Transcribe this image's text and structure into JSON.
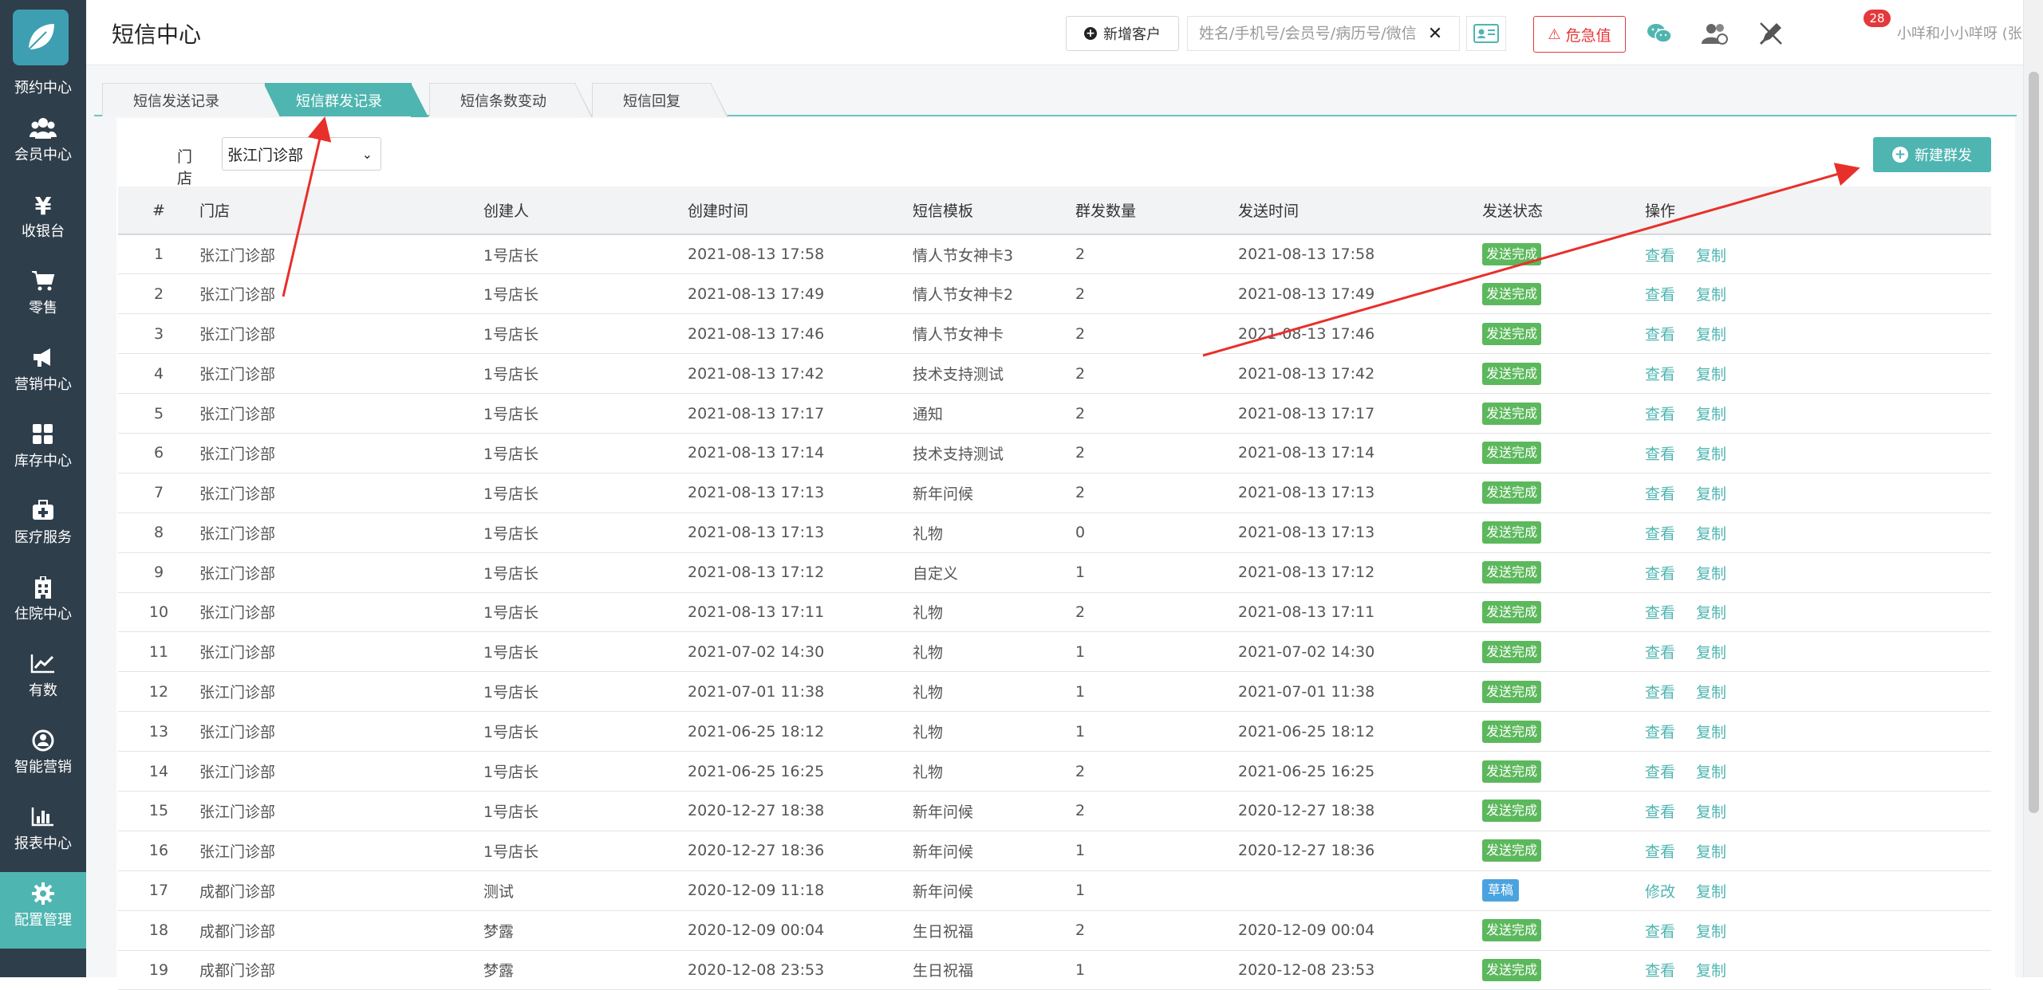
{
  "sidebar": {
    "partial_label": "预约中心",
    "items": [
      {
        "label": "会员中心",
        "icon": "members-icon"
      },
      {
        "label": "收银台",
        "icon": "yen-icon"
      },
      {
        "label": "零售",
        "icon": "cart-icon"
      },
      {
        "label": "营销中心",
        "icon": "megaphone-icon"
      },
      {
        "label": "库存中心",
        "icon": "grid-icon"
      },
      {
        "label": "医疗服务",
        "icon": "medical-kit-icon"
      },
      {
        "label": "住院中心",
        "icon": "hospital-icon"
      },
      {
        "label": "有数",
        "icon": "trend-icon"
      },
      {
        "label": "智能营销",
        "icon": "smart-marketing-icon"
      },
      {
        "label": "报表中心",
        "icon": "bar-chart-icon"
      },
      {
        "label": "配置管理",
        "icon": "gear-icon",
        "active": true
      }
    ]
  },
  "header": {
    "title": "短信中心",
    "add_customer": "新增客户",
    "search_placeholder": "姓名/手机号/会员号/病历号/微信号",
    "urgent": "危急值",
    "badge_count": "28",
    "user": "小咩和小小咩呀 (张江门诊部)"
  },
  "tabs": [
    {
      "label": "短信发送记录",
      "active": false
    },
    {
      "label": "短信群发记录",
      "active": true
    },
    {
      "label": "短信条数变动",
      "active": false
    },
    {
      "label": "短信回复",
      "active": false
    }
  ],
  "filter": {
    "store_label": "门店",
    "store_value": "张江门诊部"
  },
  "new_group_button": "新建群发",
  "table": {
    "columns": [
      "#",
      "门店",
      "创建人",
      "创建时间",
      "短信模板",
      "群发数量",
      "发送时间",
      "发送状态",
      "操作"
    ],
    "rows": [
      {
        "n": "1",
        "store": "张江门诊部",
        "creator": "1号店长",
        "created": "2021-08-13 17:58",
        "template": "情人节女神卡3",
        "count": "2",
        "sent": "2021-08-13 17:58",
        "status": "发送完成",
        "ops": [
          "查看",
          "复制"
        ]
      },
      {
        "n": "2",
        "store": "张江门诊部",
        "creator": "1号店长",
        "created": "2021-08-13 17:49",
        "template": "情人节女神卡2",
        "count": "2",
        "sent": "2021-08-13 17:49",
        "status": "发送完成",
        "ops": [
          "查看",
          "复制"
        ]
      },
      {
        "n": "3",
        "store": "张江门诊部",
        "creator": "1号店长",
        "created": "2021-08-13 17:46",
        "template": "情人节女神卡",
        "count": "2",
        "sent": "2021-08-13 17:46",
        "status": "发送完成",
        "ops": [
          "查看",
          "复制"
        ]
      },
      {
        "n": "4",
        "store": "张江门诊部",
        "creator": "1号店长",
        "created": "2021-08-13 17:42",
        "template": "技术支持测试",
        "count": "2",
        "sent": "2021-08-13 17:42",
        "status": "发送完成",
        "ops": [
          "查看",
          "复制"
        ]
      },
      {
        "n": "5",
        "store": "张江门诊部",
        "creator": "1号店长",
        "created": "2021-08-13 17:17",
        "template": "通知",
        "count": "2",
        "sent": "2021-08-13 17:17",
        "status": "发送完成",
        "ops": [
          "查看",
          "复制"
        ]
      },
      {
        "n": "6",
        "store": "张江门诊部",
        "creator": "1号店长",
        "created": "2021-08-13 17:14",
        "template": "技术支持测试",
        "count": "2",
        "sent": "2021-08-13 17:14",
        "status": "发送完成",
        "ops": [
          "查看",
          "复制"
        ]
      },
      {
        "n": "7",
        "store": "张江门诊部",
        "creator": "1号店长",
        "created": "2021-08-13 17:13",
        "template": "新年问候",
        "count": "2",
        "sent": "2021-08-13 17:13",
        "status": "发送完成",
        "ops": [
          "查看",
          "复制"
        ]
      },
      {
        "n": "8",
        "store": "张江门诊部",
        "creator": "1号店长",
        "created": "2021-08-13 17:13",
        "template": "礼物",
        "count": "0",
        "sent": "2021-08-13 17:13",
        "status": "发送完成",
        "ops": [
          "查看",
          "复制"
        ]
      },
      {
        "n": "9",
        "store": "张江门诊部",
        "creator": "1号店长",
        "created": "2021-08-13 17:12",
        "template": "自定义",
        "count": "1",
        "sent": "2021-08-13 17:12",
        "status": "发送完成",
        "ops": [
          "查看",
          "复制"
        ]
      },
      {
        "n": "10",
        "store": "张江门诊部",
        "creator": "1号店长",
        "created": "2021-08-13 17:11",
        "template": "礼物",
        "count": "2",
        "sent": "2021-08-13 17:11",
        "status": "发送完成",
        "ops": [
          "查看",
          "复制"
        ]
      },
      {
        "n": "11",
        "store": "张江门诊部",
        "creator": "1号店长",
        "created": "2021-07-02 14:30",
        "template": "礼物",
        "count": "1",
        "sent": "2021-07-02 14:30",
        "status": "发送完成",
        "ops": [
          "查看",
          "复制"
        ]
      },
      {
        "n": "12",
        "store": "张江门诊部",
        "creator": "1号店长",
        "created": "2021-07-01 11:38",
        "template": "礼物",
        "count": "1",
        "sent": "2021-07-01 11:38",
        "status": "发送完成",
        "ops": [
          "查看",
          "复制"
        ]
      },
      {
        "n": "13",
        "store": "张江门诊部",
        "creator": "1号店长",
        "created": "2021-06-25 18:12",
        "template": "礼物",
        "count": "1",
        "sent": "2021-06-25 18:12",
        "status": "发送完成",
        "ops": [
          "查看",
          "复制"
        ]
      },
      {
        "n": "14",
        "store": "张江门诊部",
        "creator": "1号店长",
        "created": "2021-06-25 16:25",
        "template": "礼物",
        "count": "2",
        "sent": "2021-06-25 16:25",
        "status": "发送完成",
        "ops": [
          "查看",
          "复制"
        ]
      },
      {
        "n": "15",
        "store": "张江门诊部",
        "creator": "1号店长",
        "created": "2020-12-27 18:38",
        "template": "新年问候",
        "count": "2",
        "sent": "2020-12-27 18:38",
        "status": "发送完成",
        "ops": [
          "查看",
          "复制"
        ]
      },
      {
        "n": "16",
        "store": "张江门诊部",
        "creator": "1号店长",
        "created": "2020-12-27 18:36",
        "template": "新年问候",
        "count": "1",
        "sent": "2020-12-27 18:36",
        "status": "发送完成",
        "ops": [
          "查看",
          "复制"
        ]
      },
      {
        "n": "17",
        "store": "成都门诊部",
        "creator": "测试",
        "created": "2020-12-09 11:18",
        "template": "新年问候",
        "count": "1",
        "sent": "",
        "status": "草稿",
        "ops": [
          "修改",
          "复制"
        ]
      },
      {
        "n": "18",
        "store": "成都门诊部",
        "creator": "梦露",
        "created": "2020-12-09 00:04",
        "template": "生日祝福",
        "count": "2",
        "sent": "2020-12-09 00:04",
        "status": "发送完成",
        "ops": [
          "查看",
          "复制"
        ]
      },
      {
        "n": "19",
        "store": "成都门诊部",
        "creator": "梦露",
        "created": "2020-12-08 23:53",
        "template": "生日祝福",
        "count": "1",
        "sent": "2020-12-08 23:53",
        "status": "发送完成",
        "ops": [
          "查看",
          "复制"
        ]
      }
    ]
  },
  "colors": {
    "sidebar": "#2f3e4b",
    "accent": "#4fb5b1",
    "status_done": "#5cb85c",
    "status_draft": "#4aa3df",
    "danger": "#e4393c",
    "annotation_arrow": "#e8302a"
  }
}
